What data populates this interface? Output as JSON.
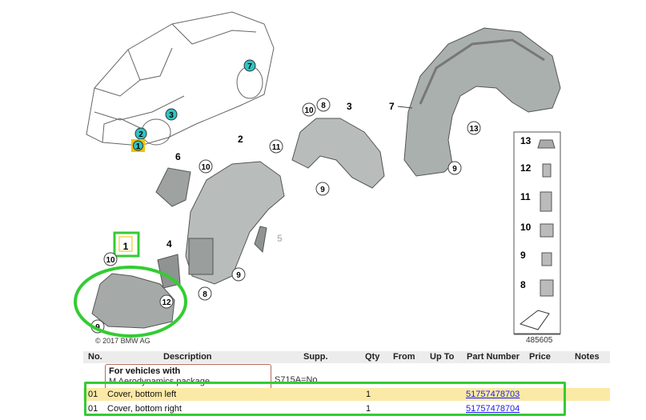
{
  "diagram": {
    "callouts": [
      "1",
      "2",
      "3",
      "4",
      "5",
      "6",
      "7",
      "8",
      "9",
      "10",
      "11",
      "12",
      "13"
    ],
    "hints": {
      "car_1": "1",
      "car_2": "2",
      "car_3": "3",
      "car_7": "7"
    },
    "copyright": "© 2017 BMW AG",
    "image_id": "485605",
    "legend": [
      "13",
      "12",
      "11",
      "10",
      "9",
      "8"
    ]
  },
  "table": {
    "headers": {
      "no": "No.",
      "description": "Description",
      "supp": "Supp.",
      "qty": "Qty",
      "from": "From",
      "up_to": "Up To",
      "part_number": "Part Number",
      "price": "Price",
      "notes": "Notes"
    },
    "note": {
      "line1": "For vehicles with",
      "line2": "M Aerodynamics package",
      "supp": "S715A=No"
    },
    "rows": [
      {
        "no": "01",
        "description": "Cover, bottom left",
        "qty": "1",
        "part_number": "51757478703"
      },
      {
        "no": "01",
        "description": "Cover, bottom right",
        "qty": "1",
        "part_number": "51757478704"
      }
    ]
  },
  "colors": {
    "highlight": "#fbe9a6",
    "annotation_green": "#33cc33",
    "callout_teal": "#2fc4c4",
    "callout_yellow": "#f2c200",
    "link": "#1a1aee"
  }
}
